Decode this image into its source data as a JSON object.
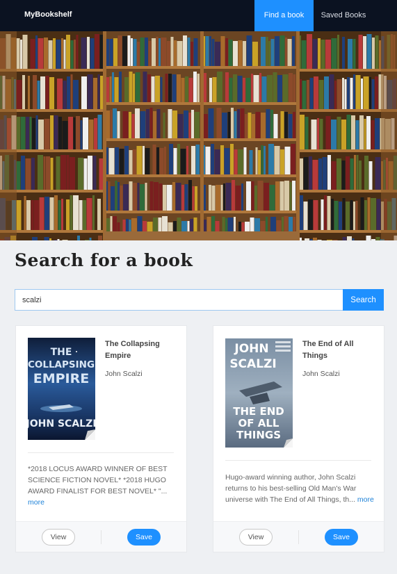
{
  "nav": {
    "brand": "MyBookshelf",
    "links": [
      {
        "label": "Find a book",
        "active": true
      },
      {
        "label": "Saved Books",
        "active": false
      }
    ]
  },
  "hero": {
    "image": "library-bookshelves-photo"
  },
  "search": {
    "title": "Search for a book",
    "query": "scalzi",
    "button_label": "Search"
  },
  "results": [
    {
      "title": "The Collapsing Empire",
      "author": "John Scalzi",
      "cover_text": {
        "top": "THE COLLAPSING EMPIRE",
        "bottom": "JOHN SCALZI"
      },
      "description": "*2018 LOCUS AWARD WINNER OF BEST SCIENCE FICTION NOVEL* *2018 HUGO AWARD FINALIST FOR BEST NOVEL* \"...",
      "more_label": "more",
      "view_label": "View",
      "save_label": "Save"
    },
    {
      "title": "The End of All Things",
      "author": "John Scalzi",
      "cover_text": {
        "top": "JOHN SCALZI",
        "bottom": "THE END OF ALL THINGS"
      },
      "description": "Hugo-award winning author, John Scalzi returns to his best-selling Old Man's War universe with The End of All Things, th...",
      "more_label": "more",
      "view_label": "View",
      "save_label": "Save"
    }
  ],
  "colors": {
    "nav_bg": "#0b1221",
    "accent": "#1e90ff",
    "page_bg": "#eef0f3"
  }
}
